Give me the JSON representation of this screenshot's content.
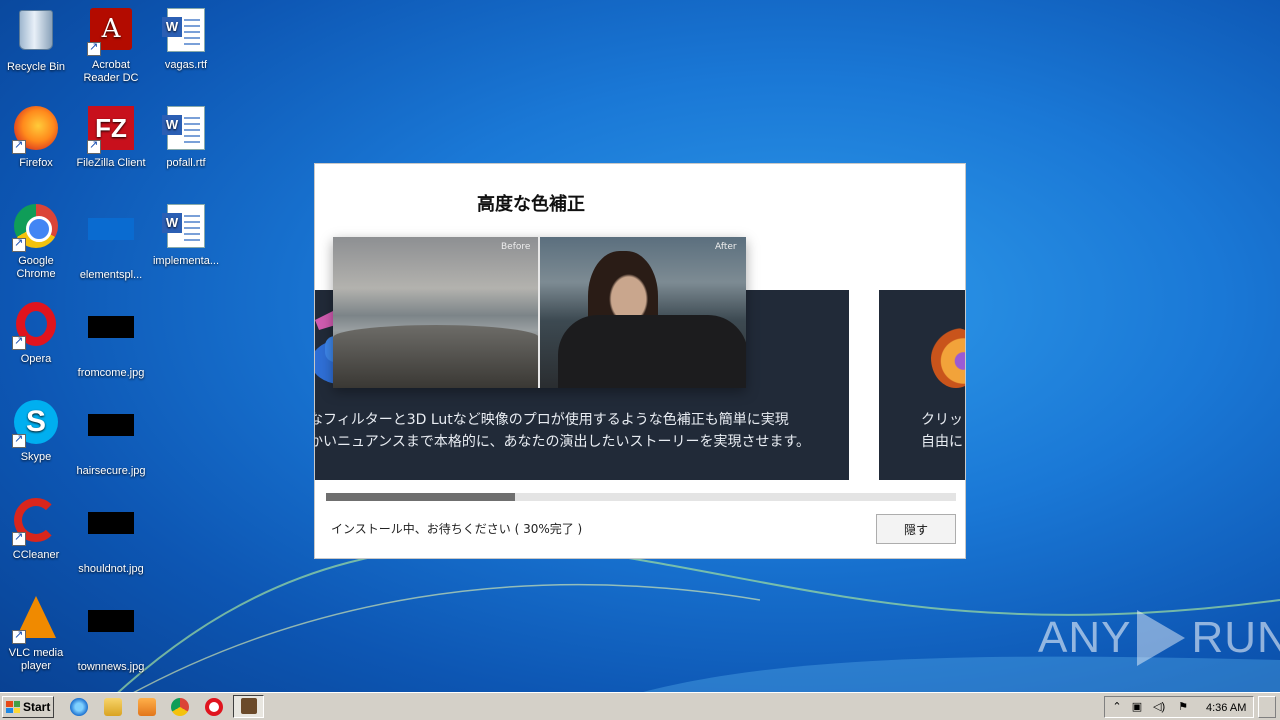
{
  "desktop": {
    "icons": [
      {
        "label": "Recycle Bin"
      },
      {
        "label": "Acrobat Reader DC"
      },
      {
        "label": "vagas.rtf"
      },
      {
        "label": "Firefox"
      },
      {
        "label": "FileZilla Client"
      },
      {
        "label": "pofall.rtf"
      },
      {
        "label": "Google Chrome"
      },
      {
        "label": "elementspl..."
      },
      {
        "label": "implementa..."
      },
      {
        "label": "Opera"
      },
      {
        "label": "fromcome.jpg"
      },
      {
        "label": "Skype"
      },
      {
        "label": "hairsecure.jpg"
      },
      {
        "label": "CCleaner"
      },
      {
        "label": "shouldnot.jpg"
      },
      {
        "label": "VLC media player"
      },
      {
        "label": "townnews.jpg"
      }
    ]
  },
  "installer": {
    "heading": "高度な色補正",
    "compare_before": "Before",
    "compare_after": "After",
    "card_a_line1": "なフィルターと3D Lutなど映像のプロが使用するような色補正も簡単に実現",
    "card_a_line2": "かいニュアンスまで本格的に、あなたの演出したいストーリーを実現させます。",
    "card_b_line1": "クリッ",
    "card_b_line2": "自由に",
    "progress_fraction": 0.3,
    "status": "インストール中、お待ちください ( 30%完了 )",
    "hide_button": "隠す"
  },
  "watermark": {
    "text_left": "ANY",
    "text_right": "RUN"
  },
  "taskbar": {
    "start_label": "Start",
    "clock": "4:36 AM",
    "pinned": [
      "ie-icon",
      "explorer-icon",
      "media-player-icon",
      "chrome-icon",
      "opera-icon",
      "installer-app-icon"
    ]
  }
}
